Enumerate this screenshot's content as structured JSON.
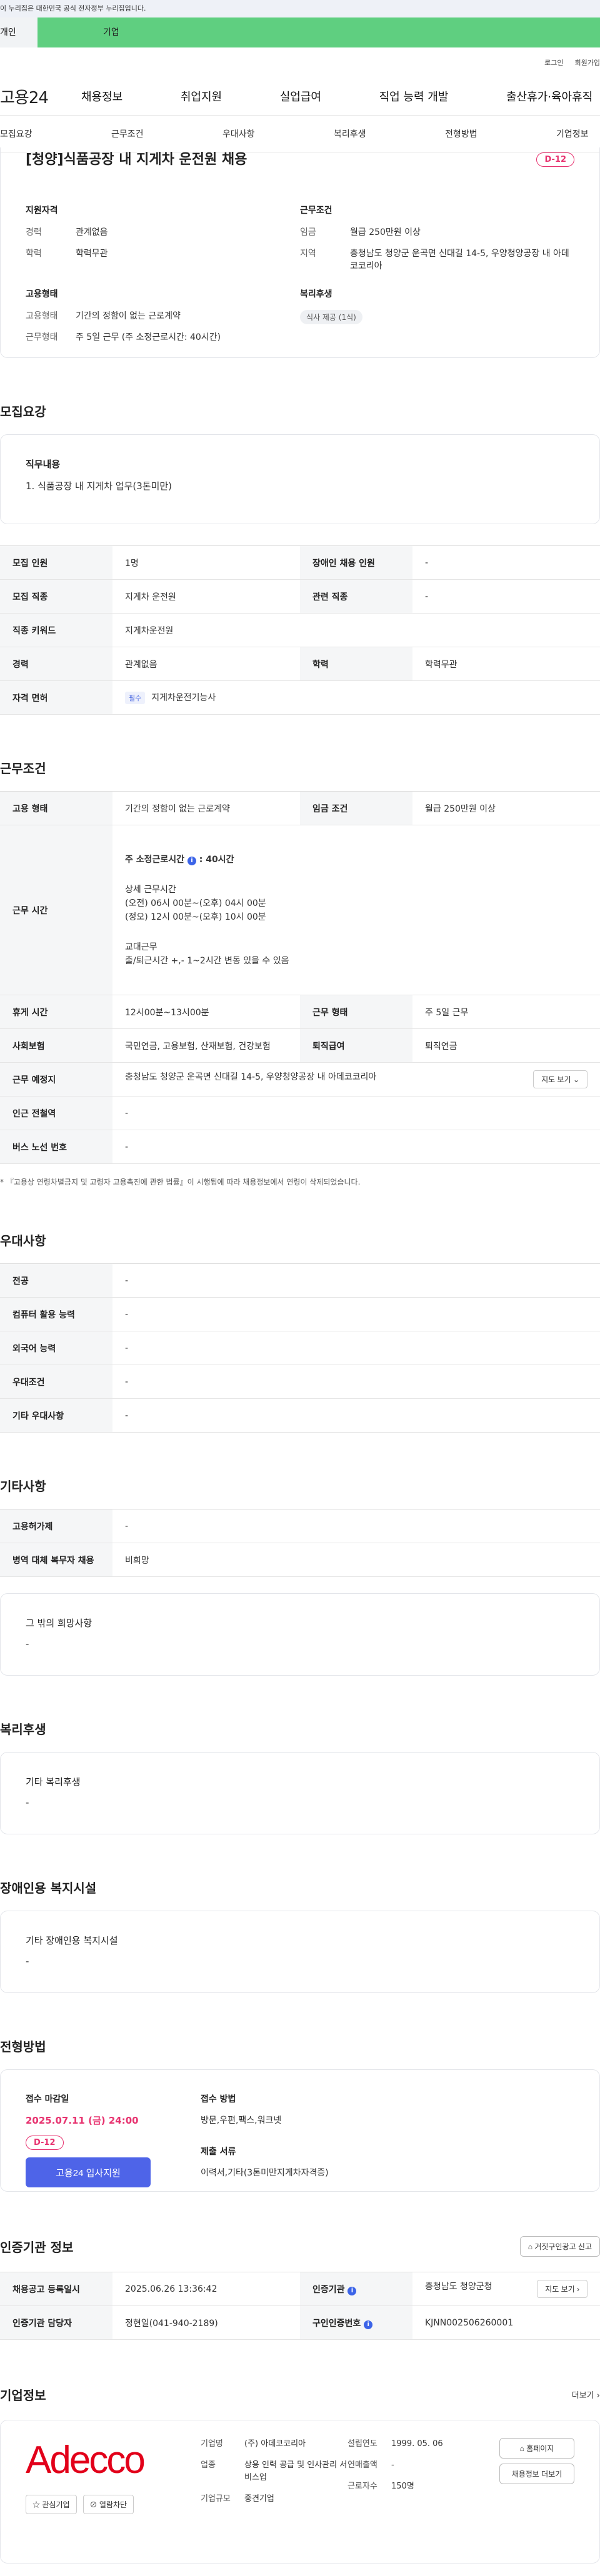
{
  "gov_banner": "이 누리집은 대한민국 공식 전자정부 누리집입니다.",
  "user_tabs": [
    "개인",
    "기업"
  ],
  "util_links": [
    "로그인",
    "회원가입"
  ],
  "gnb": {
    "logo": "고용24",
    "menu": [
      "채용정보",
      "취업지원",
      "실업급여",
      "직업 능력 개발",
      "출산휴가·육아휴직"
    ]
  },
  "anchor_nav": [
    "모집요강",
    "근무조건",
    "우대사항",
    "복리후생",
    "전형방법",
    "기업정보"
  ],
  "summary": {
    "title": "[청양]식품공장 내 지게차 운전원 채용",
    "dday": "D-12",
    "qualification": {
      "head": "지원자격",
      "rows": [
        {
          "k": "경력",
          "v": "관계없음"
        },
        {
          "k": "학력",
          "v": "학력무관"
        }
      ]
    },
    "employment": {
      "head": "고용형태",
      "rows": [
        {
          "k": "고용형태",
          "v": "기간의 정함이 없는 근로계약"
        },
        {
          "k": "근무형태",
          "v": "주 5일 근무 (주 소정근로시간: 40시간)"
        }
      ]
    },
    "conditions": {
      "head": "근무조건",
      "rows": [
        {
          "k": "임금",
          "v": "월급 250만원 이상"
        },
        {
          "k": "지역",
          "v": "충청남도 청양군 운곡면 신대길 14-5, 우양청양공장 내 아데코코리아"
        }
      ]
    },
    "welfare": {
      "head": "복리후생",
      "chip": "식사 제공 (1식)"
    }
  },
  "recruit": {
    "title": "모집요강",
    "duty_head": "직무내용",
    "duty_value": "1. 식품공장 내 지게차 업무(3톤미만)",
    "table": [
      [
        {
          "k": "모집 인원",
          "v": "1명"
        },
        {
          "k": "장애인 채용 인원",
          "v": "-"
        }
      ],
      [
        {
          "k": "모집 직종",
          "v": "지게차 운전원"
        },
        {
          "k": "관련 직종",
          "v": "-"
        }
      ],
      [
        {
          "k": "직종 키워드",
          "v": "지게차운전원"
        }
      ],
      [
        {
          "k": "경력",
          "v": "관계없음"
        },
        {
          "k": "학력",
          "v": "학력무관"
        }
      ],
      [
        {
          "k": "자격 면허",
          "chip": "필수",
          "v": "지게차운전기능사"
        }
      ]
    ]
  },
  "work": {
    "title": "근무조건",
    "type_k": "고용 형태",
    "type_v": "기간의 정함이 없는 근로계약",
    "wage_k": "임금 조건",
    "wage_v": "월급 250만원 이상",
    "hours_k": "근무 시간",
    "hours_total": "주 소정근로시간",
    "hours_total_v": "40시간",
    "hours_detail_head": "상세 근무시간",
    "hours_detail": [
      "(오전) 06시 00분~(오후) 04시 00분",
      "(정오) 12시 00분~(오후) 10시 00분"
    ],
    "shift_head": "교대근무",
    "shift_v": "출/퇴근시간 +,- 1~2시간 변동 있을 수 있음",
    "break_k": "휴게 시간",
    "break_v": "12시00분~13시00분",
    "form_k": "근무 형태",
    "form_v": "주 5일 근무",
    "insurance_k": "사회보험",
    "insurance_v": "국민연금, 고용보험, 산재보험, 건강보험",
    "pension_k": "퇴직급여",
    "pension_v": "퇴직연금",
    "place_k": "근무 예정지",
    "place_v": "충청남도 청양군 운곡면 신대길 14-5, 우양청양공장 내 아데코코리아",
    "map_btn": "지도 보기",
    "station_k": "인근 전철역",
    "station_v": "-",
    "bus_k": "버스 노선 번호",
    "bus_v": "-",
    "note": "* 『고용상 연령차별금지 및 고령자 고용촉진에 관한 법률』이 시행됨에 따라 채용정보에서 연령이 삭제되었습니다."
  },
  "prefer": {
    "title": "우대사항",
    "rows": [
      {
        "k": "전공",
        "v": "-"
      },
      {
        "k": "컴퓨터 활용 능력",
        "v": "-"
      },
      {
        "k": "외국어 능력",
        "v": "-"
      },
      {
        "k": "우대조건",
        "v": "-"
      },
      {
        "k": "기타 우대사항",
        "v": "-"
      }
    ]
  },
  "other": {
    "title": "기타사항",
    "rows": [
      {
        "k": "고용허가제",
        "v": "-"
      },
      {
        "k": "병역 대체 복무자 채용",
        "v": "비희망"
      }
    ],
    "box_head": "그 밖의 희망사항",
    "box_value": "-"
  },
  "welfare": {
    "title": "복리후생",
    "box_head": "기타 복리후생",
    "box_value": "-"
  },
  "disability": {
    "title": "장애인용 복지시설",
    "box_head": "기타 장애인용 복지시설",
    "box_value": "-"
  },
  "selection": {
    "title": "전형방법",
    "deadline_head": "접수 마감일",
    "deadline": "2025.07.11 (금) 24:00",
    "dday": "D-12",
    "apply_btn": "고용24 입사지원",
    "method_head": "접수 방법",
    "method_v": "방문,우편,팩스,워크넷",
    "docs_head": "제출 서류",
    "docs_v": "이력서,기타(3톤미만지게차자격증)"
  },
  "agency": {
    "title": "인증기관 정보",
    "report_btn": "거짓구인광고 신고",
    "reg_k": "채용공고 등록일시",
    "reg_v": "2025.06.26 13:36:42",
    "org_k": "인증기관",
    "org_v": "충청남도 청양군청",
    "map_btn": "지도 보기",
    "manager_k": "인증기관 담당자",
    "manager_v": "정현일(041-940-2189)",
    "cert_k": "구인인증번호",
    "cert_v": "KJNN002506260001"
  },
  "company": {
    "title": "기업정보",
    "more": "더보기",
    "logo": "Adecco",
    "btn_interest": "관심기업",
    "btn_block": "열람차단",
    "name_k": "기업명",
    "name_v": "(주) 아데코코리아",
    "industry_k": "업종",
    "industry_v": "상용 인력 공급 및 인사관리 서비스업",
    "size_k": "기업규모",
    "size_v": "중견기업",
    "founded_k": "설립연도",
    "founded_v": "1999. 05. 06",
    "sales_k": "연매출액",
    "sales_v": "-",
    "employees_k": "근로자수",
    "employees_v": "150명",
    "homepage_btn": "홈페이지",
    "jobs_btn": "채용정보 더보기"
  }
}
